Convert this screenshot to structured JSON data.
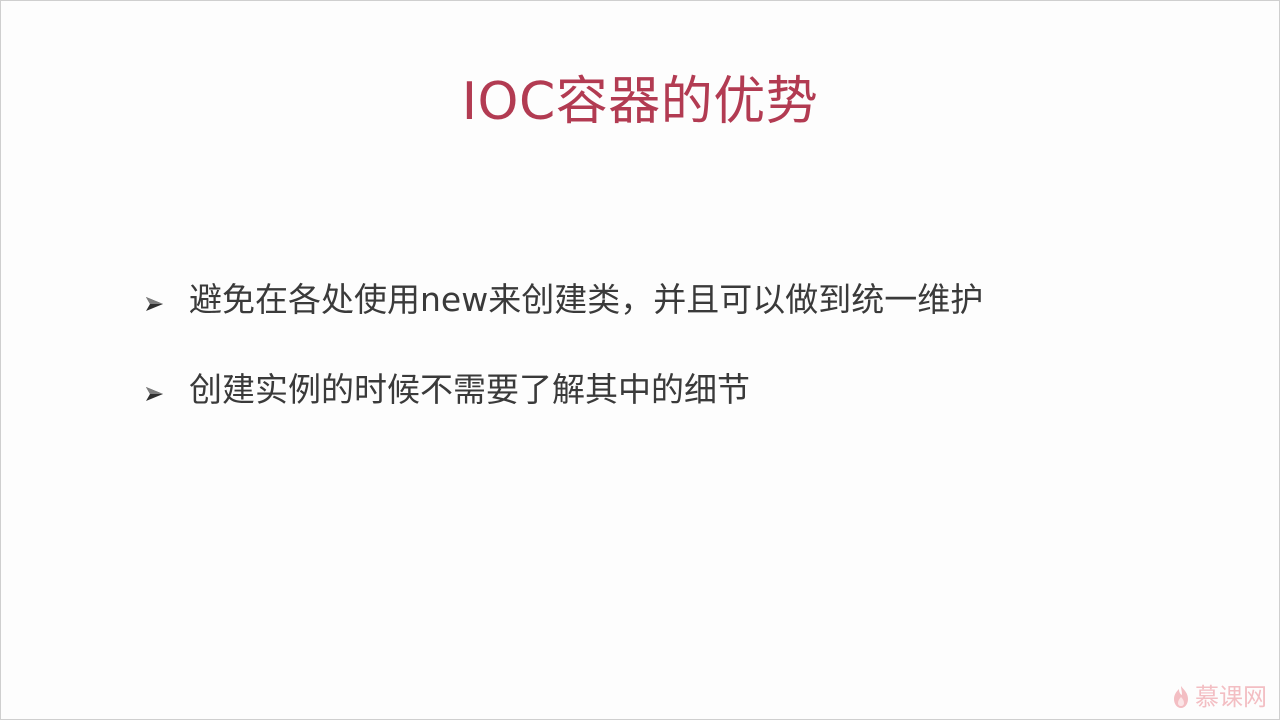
{
  "slide": {
    "title": "IOC容器的优势",
    "bullets": [
      "避免在各处使用new来创建类，并且可以做到统一维护",
      "创建实例的时候不需要了解其中的细节"
    ],
    "watermark": "慕课网"
  },
  "colors": {
    "title": "#b23b52",
    "bullet_text": "#3a3a3a",
    "watermark": "#f2b8bd"
  },
  "icons": {
    "bullet": "arrowhead-bullet-icon",
    "watermark": "flame-icon"
  }
}
